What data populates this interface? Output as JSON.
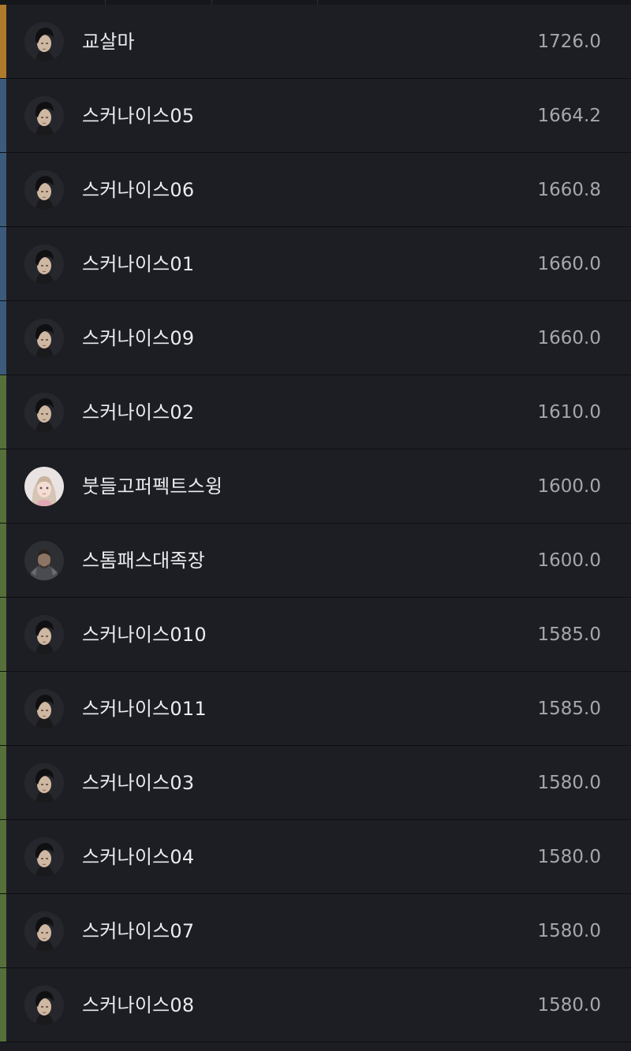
{
  "colors": {
    "gold": "#b07a2c",
    "blue": "#3b5a7c",
    "green": "#55703a",
    "background": "#1c1d22",
    "name_text": "#ececee",
    "score_text": "#a6a7ad"
  },
  "rows": [
    {
      "name": "교살마",
      "score": "1726.0",
      "tier": "gold",
      "avatar": "dark-haired-male-portrait"
    },
    {
      "name": "스커나이스05",
      "score": "1664.2",
      "tier": "blue",
      "avatar": "dark-haired-male-portrait"
    },
    {
      "name": "스커나이스06",
      "score": "1660.8",
      "tier": "blue",
      "avatar": "dark-haired-male-portrait"
    },
    {
      "name": "스커나이스01",
      "score": "1660.0",
      "tier": "blue",
      "avatar": "dark-haired-male-portrait"
    },
    {
      "name": "스커나이스09",
      "score": "1660.0",
      "tier": "blue",
      "avatar": "dark-haired-male-portrait"
    },
    {
      "name": "스커나이스02",
      "score": "1610.0",
      "tier": "green",
      "avatar": "dark-haired-male-portrait"
    },
    {
      "name": "붓들고퍼펙트스윙",
      "score": "1600.0",
      "tier": "green",
      "avatar": "blonde-female-portrait"
    },
    {
      "name": "스톰패스대족장",
      "score": "1600.0",
      "tier": "green",
      "avatar": "armored-warrior-portrait"
    },
    {
      "name": "스커나이스010",
      "score": "1585.0",
      "tier": "green",
      "avatar": "dark-haired-male-portrait"
    },
    {
      "name": "스커나이스011",
      "score": "1585.0",
      "tier": "green",
      "avatar": "dark-haired-male-portrait"
    },
    {
      "name": "스커나이스03",
      "score": "1580.0",
      "tier": "green",
      "avatar": "dark-haired-male-portrait"
    },
    {
      "name": "스커나이스04",
      "score": "1580.0",
      "tier": "green",
      "avatar": "dark-haired-male-portrait"
    },
    {
      "name": "스커나이스07",
      "score": "1580.0",
      "tier": "green",
      "avatar": "dark-haired-male-portrait"
    },
    {
      "name": "스커나이스08",
      "score": "1580.0",
      "tier": "green",
      "avatar": "dark-haired-male-portrait"
    }
  ]
}
